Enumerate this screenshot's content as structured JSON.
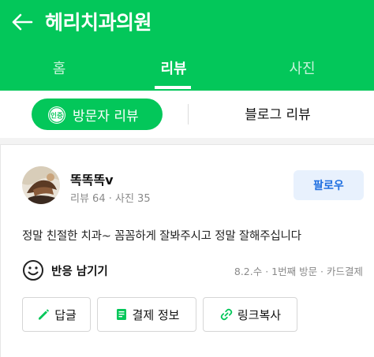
{
  "header": {
    "back_icon": "arrow-left-icon",
    "title": "헤리치과의원",
    "bg_color": "#03c75a"
  },
  "tabs": [
    {
      "label": "홈",
      "active": false
    },
    {
      "label": "리뷰",
      "active": true
    },
    {
      "label": "사진",
      "active": false
    }
  ],
  "subtabs": {
    "visitor": {
      "badge": "인증",
      "label": "방문자 리뷰",
      "active": true
    },
    "blog": {
      "label": "블로그 리뷰",
      "active": false
    }
  },
  "review": {
    "author": "똑똑똑v",
    "stats": "리뷰 64 · 사진 35",
    "follow_label": "팔로우",
    "text": "정말 친절한 치과~ 꼼꼼하게 잘봐주시고 정말 잘해주십니다",
    "reaction_label": "반응 남기기",
    "visit_info": "8.2.수 · 1번째 방문 · 카드결제",
    "buttons": [
      {
        "label": "답글",
        "icon": "pencil-icon"
      },
      {
        "label": "결제 정보",
        "icon": "receipt-icon"
      },
      {
        "label": "링크복사",
        "icon": "link-icon"
      }
    ]
  },
  "colors": {
    "accent": "#03c75a",
    "follow_text": "#1f6fe0",
    "follow_bg": "#e8f1fd"
  }
}
